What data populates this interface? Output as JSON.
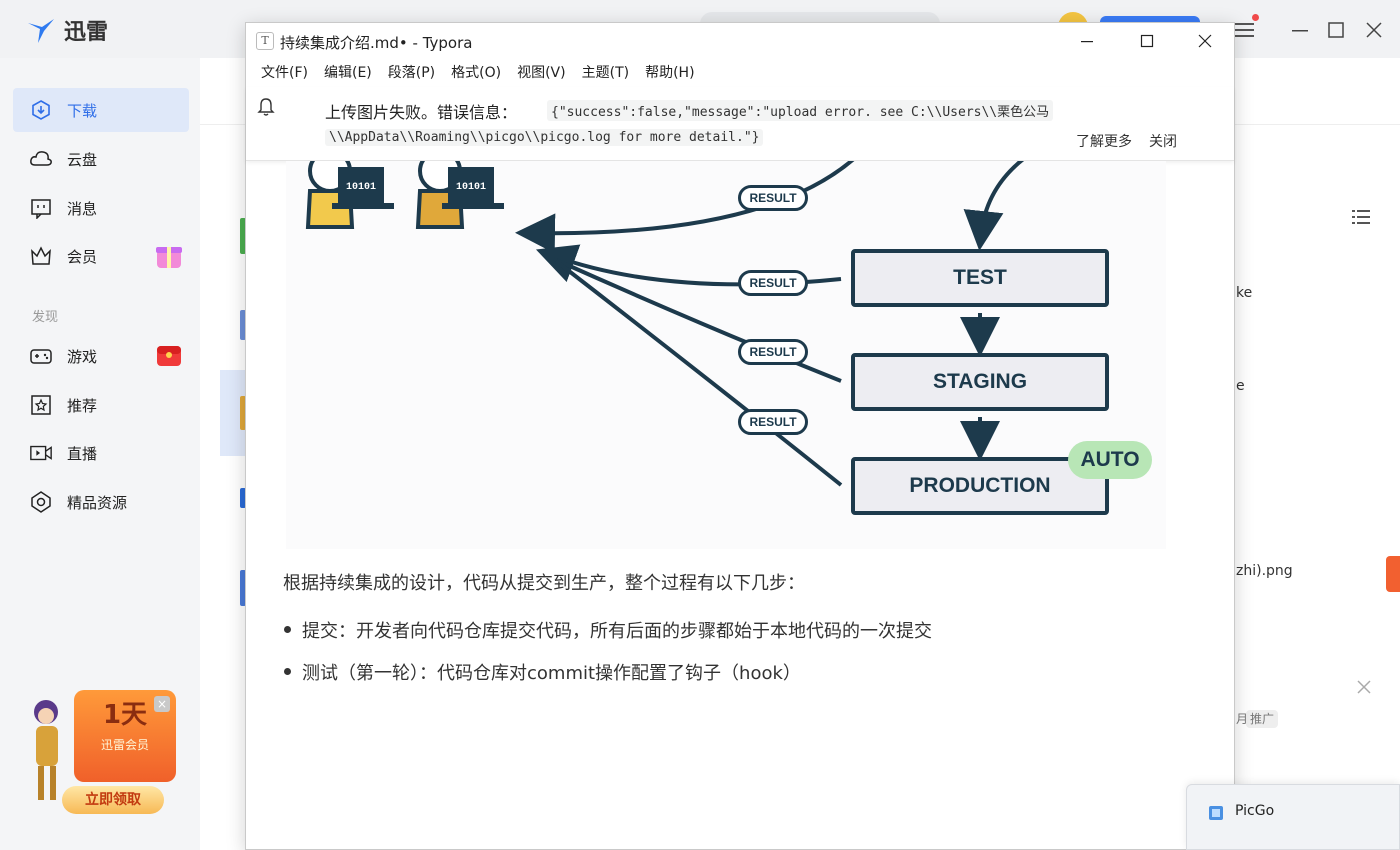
{
  "xunlei": {
    "brand": "迅雷",
    "sidebar": {
      "items": [
        {
          "label": "下载",
          "icon": "download-icon"
        },
        {
          "label": "云盘",
          "icon": "cloud-icon"
        },
        {
          "label": "消息",
          "icon": "message-icon"
        },
        {
          "label": "会员",
          "icon": "crown-icon"
        }
      ],
      "section_label": "发现",
      "discover_items": [
        {
          "label": "游戏",
          "icon": "gamepad-icon"
        },
        {
          "label": "推荐",
          "icon": "star-icon"
        },
        {
          "label": "直播",
          "icon": "video-icon"
        },
        {
          "label": "精品资源",
          "icon": "gem-icon"
        }
      ]
    },
    "promo": {
      "days": "1天",
      "vip": "迅雷会员",
      "claim": "立即领取"
    },
    "right_fragments": {
      "r1": "ke",
      "r2": "e",
      "r3": "zhi).png",
      "r4": "推广",
      "r5": "月"
    }
  },
  "typora": {
    "title": "持续集成介绍.md• - Typora",
    "app_icon_letter": "T",
    "menu": [
      "文件(F)",
      "编辑(E)",
      "段落(P)",
      "格式(O)",
      "视图(V)",
      "主题(T)",
      "帮助(H)"
    ],
    "notice": {
      "label": "上传图片失败。错误信息：",
      "code_line1": "{\"success\":false,\"message\":\"upload error. see C:\\\\Users\\\\栗色公马",
      "code_line2": "\\\\AppData\\\\Roaming\\\\picgo\\\\picgo.log for more detail.\"}",
      "learn_more": "了解更多",
      "close": "关闭"
    },
    "diagram": {
      "stages": [
        "TEST",
        "STAGING",
        "PRODUCTION"
      ],
      "result_label": "RESULT",
      "auto_label": "AUTO",
      "laptop_text": "10101"
    },
    "paragraph": "根据持续集成的设计，代码从提交到生产，整个过程有以下几步：",
    "bullets": [
      "提交：开发者向代码仓库提交代码，所有后面的步骤都始于本地代码的一次提交",
      "测试（第一轮）：代码仓库对commit操作配置了钩子（hook）"
    ]
  },
  "taskbar": {
    "picgo_label": "PicGo"
  },
  "colors": {
    "accent_blue": "#2f6ee8",
    "diagram_navy": "#1d3a4c",
    "auto_green": "#b8e6b6"
  }
}
